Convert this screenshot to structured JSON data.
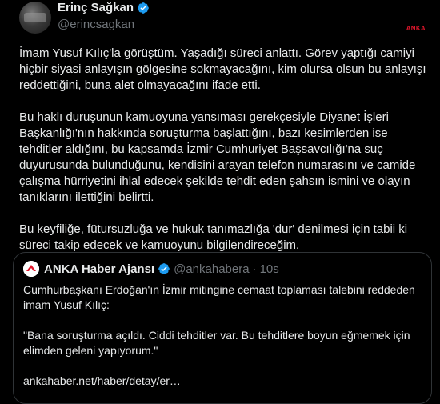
{
  "author": {
    "display_name": "Erinç Sağkan",
    "handle": "@erincsagkan",
    "verified_icon": "verified-badge-icon",
    "verified_color": "#1d9bf0"
  },
  "watermark": "ANKA",
  "watermark_color": "#e0162b",
  "tweet": {
    "paragraphs": [
      "İmam Yusuf Kılıç'la görüştüm. Yaşadığı süreci anlattı. Görev yaptığı camiyi hiçbir siyasi anlayışın gölgesine sokmayacağını, kim olursa olsun bu anlayışı reddettiğini, buna alet olmayacağını ifade etti.",
      "Bu haklı duruşunun kamuoyuna yansıması gerekçesiyle Diyanet İşleri Başkanlığı'nın hakkında soruşturma başlattığını, bazı kesimlerden ise tehditler aldığını, bu kapsamda İzmir Cumhuriyet Başsavcılığı'na suç duyurusunda bulunduğunu, kendisini arayan telefon numarasını ve camide çalışma hürriyetini ihlal edecek şekilde tehdit eden şahsın ismini ve olayın tanıklarını ilettiğini belirtti.",
      "Bu keyfiliğe, fütursuzluğa ve hukuk tanımazlığa 'dur' denilmesi için tabii ki süreci takip edecek ve kamuoyunu bilgilendireceğim."
    ]
  },
  "quoted_tweet": {
    "display_name": "ANKA Haber Ajansı",
    "verified_icon": "verified-badge-icon",
    "handle": "@ankahabera",
    "separator": "·",
    "time": "10s",
    "paragraphs": [
      "Cumhurbaşkanı Erdoğan'ın İzmir mitingine cemaat toplaması talebini reddeden imam Yusuf Kılıç:",
      "\"Bana soruşturma açıldı. Ciddi tehditler var. Bu tehditlere boyun eğmemek için elimden geleni yapıyorum.\"",
      "ankahaber.net/haber/detay/er…"
    ]
  }
}
